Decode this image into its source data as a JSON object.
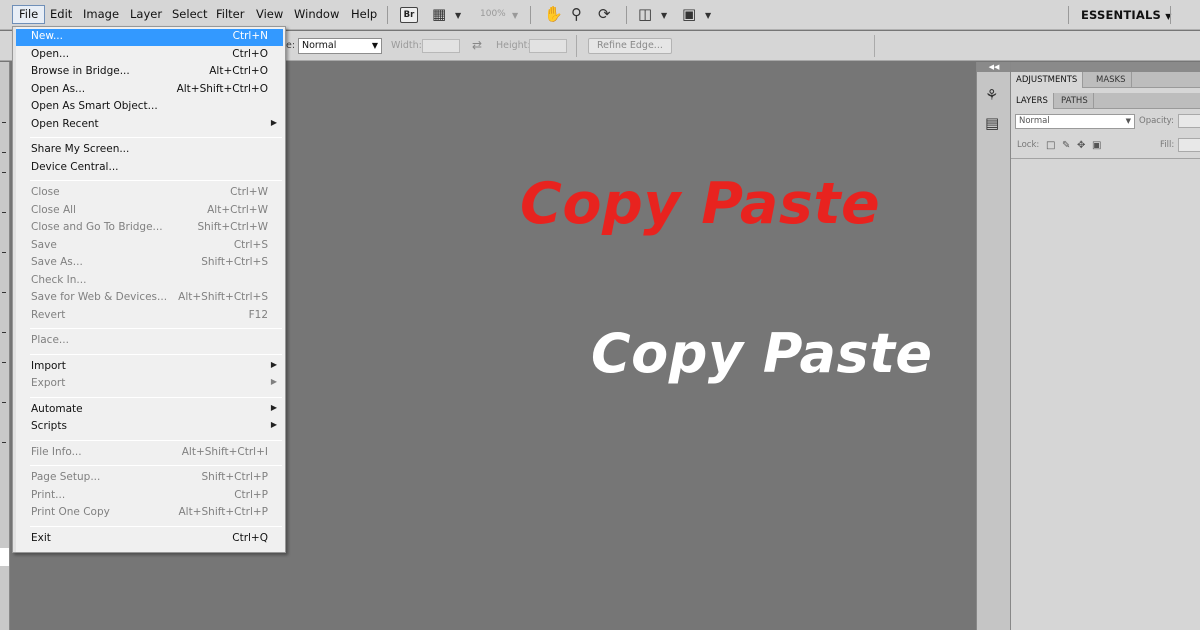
{
  "menubar": {
    "items": [
      {
        "label": "File",
        "open": true
      },
      {
        "label": "Edit"
      },
      {
        "label": "Image"
      },
      {
        "label": "Layer"
      },
      {
        "label": "Select"
      },
      {
        "label": "Filter"
      },
      {
        "label": "View"
      },
      {
        "label": "Window"
      },
      {
        "label": "Help"
      }
    ],
    "bridge_button": "Br",
    "zoom_level": "100%",
    "workspace": "ESSENTIALS"
  },
  "options_bar": {
    "style_label_fragment": "e:",
    "mode_select": "Normal",
    "width_label": "Width:",
    "height_label": "Height:",
    "refine_edge_button": "Refine Edge..."
  },
  "file_menu": {
    "groups": [
      [
        {
          "label": "New...",
          "shortcut": "Ctrl+N",
          "highlighted": true
        },
        {
          "label": "Open...",
          "shortcut": "Ctrl+O"
        },
        {
          "label": "Browse in Bridge...",
          "shortcut": "Alt+Ctrl+O"
        },
        {
          "label": "Open As...",
          "shortcut": "Alt+Shift+Ctrl+O"
        },
        {
          "label": "Open As Smart Object...",
          "shortcut": ""
        },
        {
          "label": "Open Recent",
          "shortcut": "",
          "submenu": true
        }
      ],
      [
        {
          "label": "Share My Screen...",
          "shortcut": ""
        },
        {
          "label": "Device Central...",
          "shortcut": ""
        }
      ],
      [
        {
          "label": "Close",
          "shortcut": "Ctrl+W",
          "disabled": true
        },
        {
          "label": "Close All",
          "shortcut": "Alt+Ctrl+W",
          "disabled": true
        },
        {
          "label": "Close and Go To Bridge...",
          "shortcut": "Shift+Ctrl+W",
          "disabled": true
        },
        {
          "label": "Save",
          "shortcut": "Ctrl+S",
          "disabled": true
        },
        {
          "label": "Save As...",
          "shortcut": "Shift+Ctrl+S",
          "disabled": true
        },
        {
          "label": "Check In...",
          "shortcut": "",
          "disabled": true
        },
        {
          "label": "Save for Web & Devices...",
          "shortcut": "Alt+Shift+Ctrl+S",
          "disabled": true
        },
        {
          "label": "Revert",
          "shortcut": "F12",
          "disabled": true
        }
      ],
      [
        {
          "label": "Place...",
          "shortcut": "",
          "disabled": true
        }
      ],
      [
        {
          "label": "Import",
          "shortcut": "",
          "submenu": true
        },
        {
          "label": "Export",
          "shortcut": "",
          "submenu": true,
          "disabled": true
        }
      ],
      [
        {
          "label": "Automate",
          "shortcut": "",
          "submenu": true
        },
        {
          "label": "Scripts",
          "shortcut": "",
          "submenu": true
        }
      ],
      [
        {
          "label": "File Info...",
          "shortcut": "Alt+Shift+Ctrl+I",
          "disabled": true
        }
      ],
      [
        {
          "label": "Page Setup...",
          "shortcut": "Shift+Ctrl+P",
          "disabled": true
        },
        {
          "label": "Print...",
          "shortcut": "Ctrl+P",
          "disabled": true
        },
        {
          "label": "Print One Copy",
          "shortcut": "Alt+Shift+Ctrl+P",
          "disabled": true
        }
      ],
      [
        {
          "label": "Exit",
          "shortcut": "Ctrl+Q"
        }
      ]
    ]
  },
  "canvas": {
    "text_red": "Copy Paste",
    "text_white": "Copy Paste",
    "red_color": "#e8231f",
    "white_color": "#ffffff"
  },
  "panels": {
    "top_tabs": [
      {
        "label": "ADJUSTMENTS",
        "active": true
      },
      {
        "label": "MASKS"
      }
    ],
    "layer_tabs": [
      {
        "label": "LAYERS",
        "active": true
      },
      {
        "label": "PATHS"
      }
    ],
    "blend_mode": "Normal",
    "opacity_label": "Opacity:",
    "lock_label": "Lock:",
    "fill_label": "Fill:"
  },
  "colors": {
    "highlight": "#3399ff",
    "canvas_bg": "#767676",
    "chrome_bg": "#d6d6d6"
  }
}
